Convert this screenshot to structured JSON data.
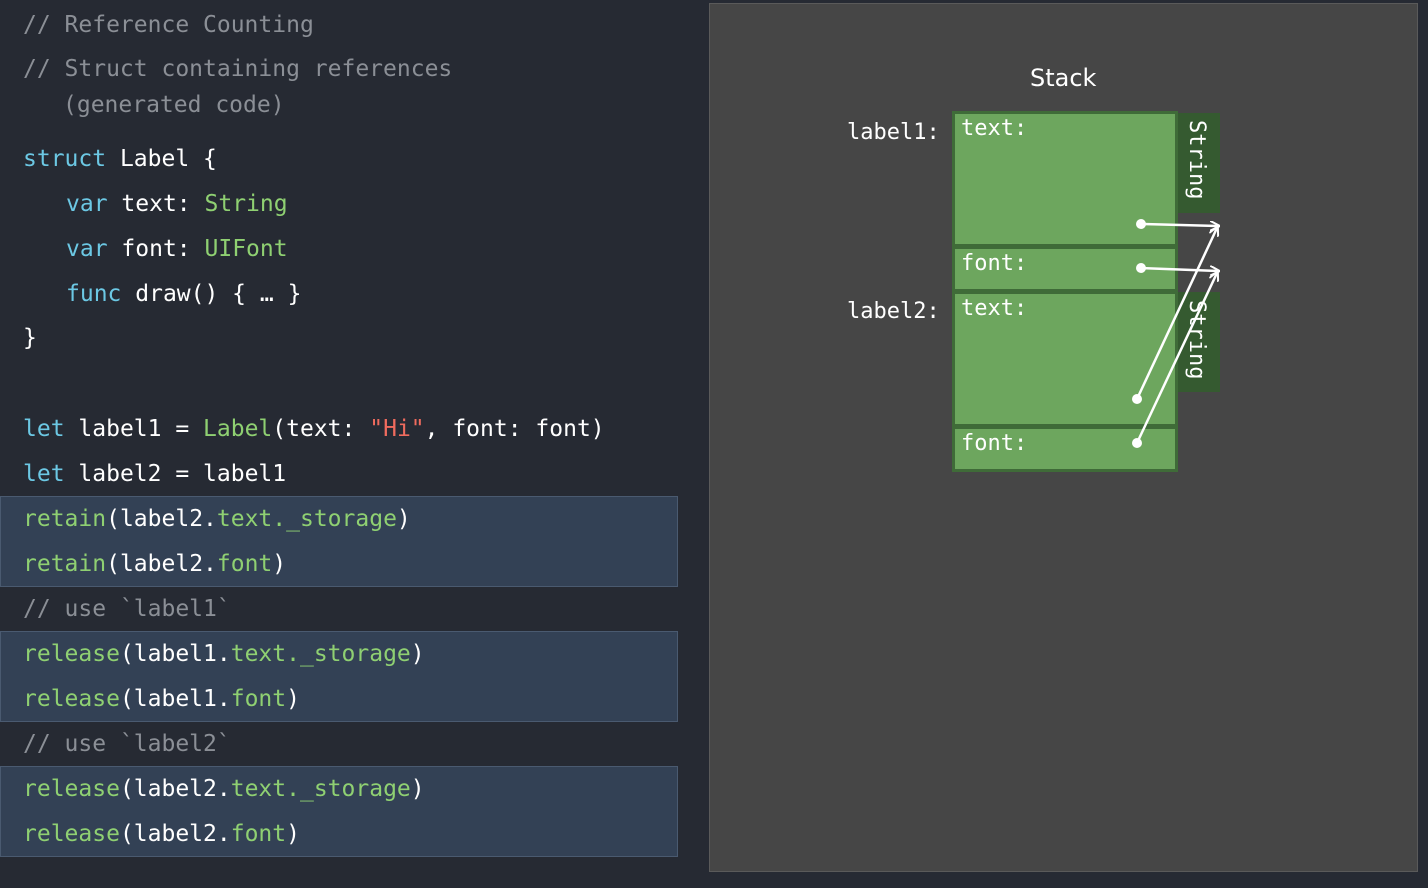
{
  "code": {
    "comment1": "// Reference Counting",
    "comment2": "// Struct containing references",
    "comment2b": "(generated code)",
    "struct_kw": "struct",
    "struct_name": "Label {",
    "var_kw": "var",
    "text_field": "text:",
    "string_type": "String",
    "font_field": "font:",
    "uifont_type": "UIFont",
    "func_kw": "func",
    "draw_sig": "draw() { … }",
    "close_brace": "}",
    "let_kw": "let",
    "l1_decl": "label1 =",
    "label_ctor": "Label",
    "ctor_args_a": "(text:",
    "hi_str": "\"Hi\"",
    "ctor_args_b": ", font: font)",
    "l2_decl": "label2 = label1",
    "retain": "retain",
    "release": "release",
    "open_paren": "(",
    "close_paren": ")",
    "label1_dot": "label1.",
    "label2_dot": "label2.",
    "text_prop": "text.",
    "storage_prop": "_storage",
    "font_prop": "font",
    "use_label1": "// use `label1`",
    "use_label2": "// use `label2`"
  },
  "stack": {
    "title": "Stack",
    "label1": "label1:",
    "label2": "label2:",
    "text_cell": "text:",
    "font_cell": "font:",
    "string_heap": "String"
  },
  "colors": {
    "background": "#262a33",
    "panel": "#464646",
    "cell_green": "#6da65e",
    "keyword": "#6cc8e4",
    "type": "#8fd072",
    "string_literal": "#ef6b5e"
  }
}
